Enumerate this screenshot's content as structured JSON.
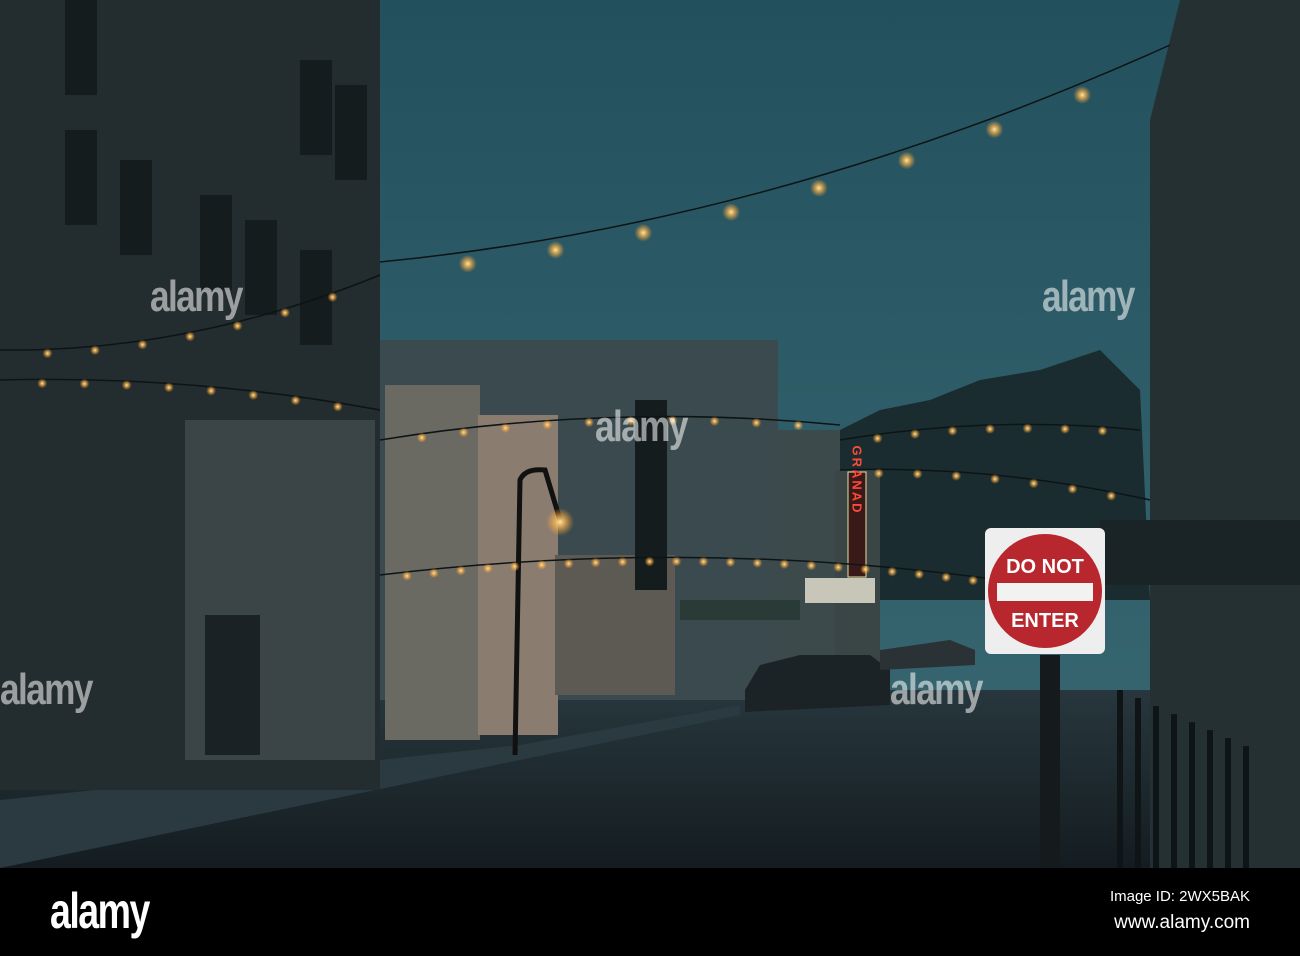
{
  "photo": {
    "sign": {
      "line1": "DO NOT",
      "line2": "ENTER"
    },
    "marquee": "GRANAD",
    "watermark": "alamy"
  },
  "footer": {
    "logo": "alamy",
    "image_id": "Image ID: 2WX5BAK",
    "url": "www.alamy.com"
  },
  "colors": {
    "sky": "#2b5a66",
    "bulb": "#ffd98a",
    "sign_red": "#b8262e",
    "neon": "#ff3b3b"
  }
}
